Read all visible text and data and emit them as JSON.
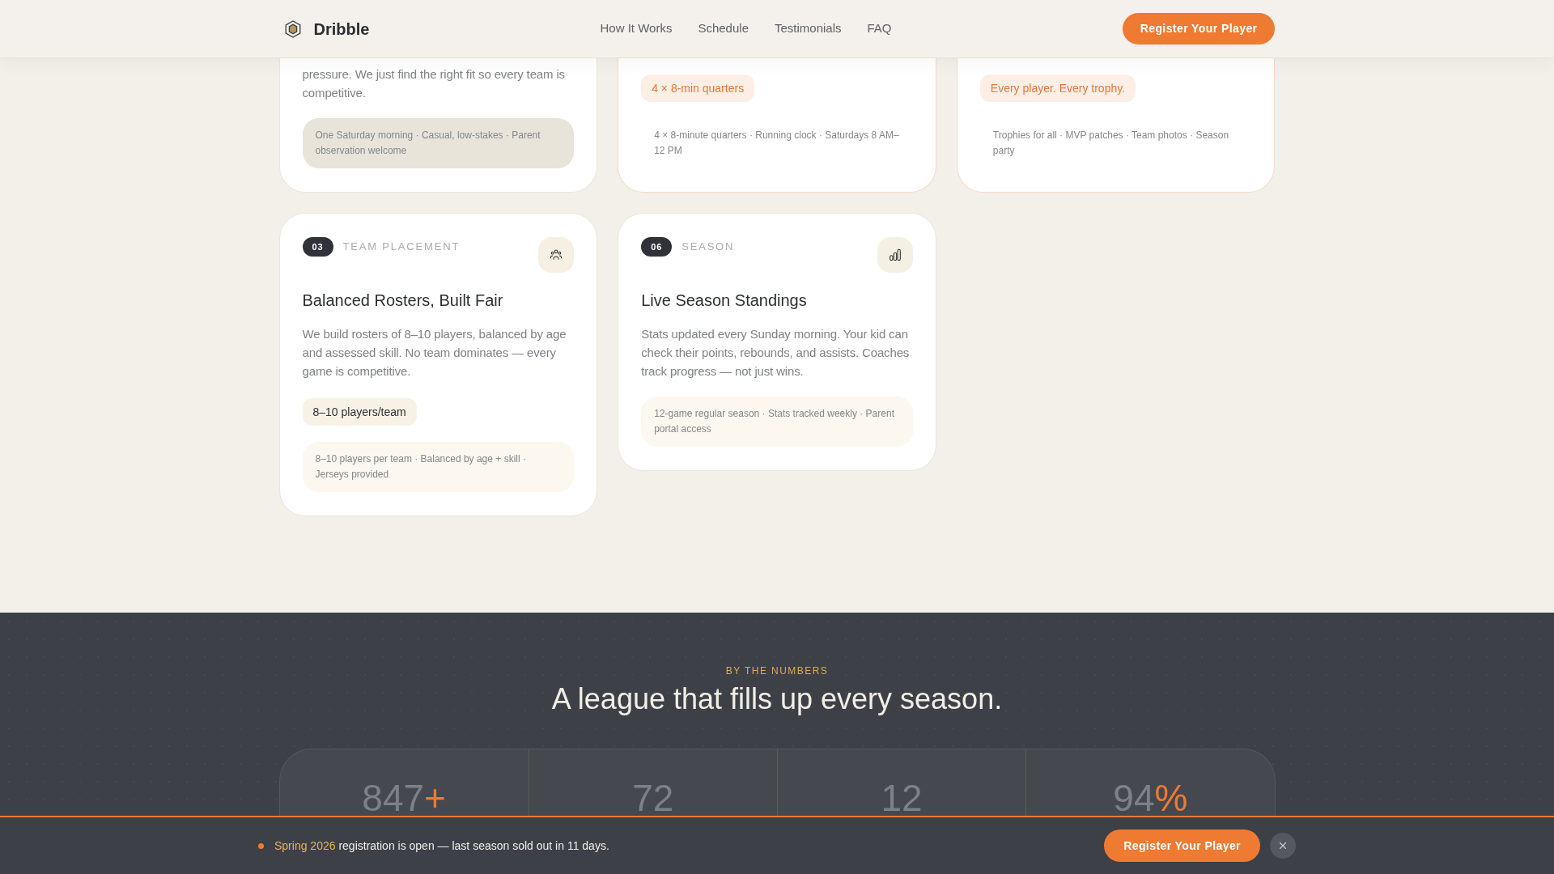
{
  "header": {
    "brand": "Dribble",
    "nav": [
      "How It Works",
      "Schedule",
      "Testimonials",
      "FAQ"
    ],
    "cta": "Register Your Player"
  },
  "features": {
    "cards": [
      {
        "kind": "clipped",
        "featured": false,
        "description": "pressure. We just find the right fit so every team is competitive.",
        "details": {
          "kind": "shaded",
          "text": "One Saturday morning · Casual, low-stakes · Parent observation welcome"
        }
      },
      {
        "kind": "clipped",
        "featured": true,
        "chip": {
          "kind": "accent",
          "text": "4 × 8-min quarters"
        },
        "details": {
          "kind": "plain",
          "text": "4 × 8-minute quarters · Running clock · Saturdays 8 AM–12 PM"
        }
      },
      {
        "kind": "clipped",
        "featured": true,
        "chip": {
          "kind": "accent",
          "text": "Every player. Every trophy."
        },
        "details": {
          "kind": "plain",
          "text": "Trophies for all · MVP patches · Team photos · Season party"
        }
      },
      {
        "kind": "full",
        "featured": false,
        "number": "03",
        "label": "TEAM PLACEMENT",
        "title": "Balanced Rosters, Built Fair",
        "description": "We build rosters of 8–10 players, balanced by age and assessed skill. No team dominates — every game is competitive.",
        "chip": {
          "kind": "neutral",
          "text": "8–10 players/team"
        },
        "details": {
          "kind": "cream",
          "text": "8–10 players per team · Balanced by age + skill · Jerseys provided"
        }
      },
      {
        "kind": "full",
        "featured": false,
        "number": "06",
        "label": "SEASON",
        "title": "Live Season Standings",
        "description": "Stats updated every Sunday morning. Your kid can check their points, rebounds, and assists. Coaches track progress — not just wins.",
        "details": {
          "kind": "cream",
          "text": "12-game regular season · Stats tracked weekly · Parent portal access"
        }
      }
    ]
  },
  "numbers": {
    "eyebrow": "BY THE NUMBERS",
    "heading": "A league that fills up every season.",
    "stats": [
      {
        "value": "847",
        "suffix": "+"
      },
      {
        "value": "72"
      },
      {
        "value": "12"
      },
      {
        "value": "94",
        "suffix": "%"
      }
    ]
  },
  "announcement": {
    "highlight": "Spring 2026",
    "message": "registration is open — last season sold out in 11 days.",
    "cta": "Register Your Player"
  }
}
